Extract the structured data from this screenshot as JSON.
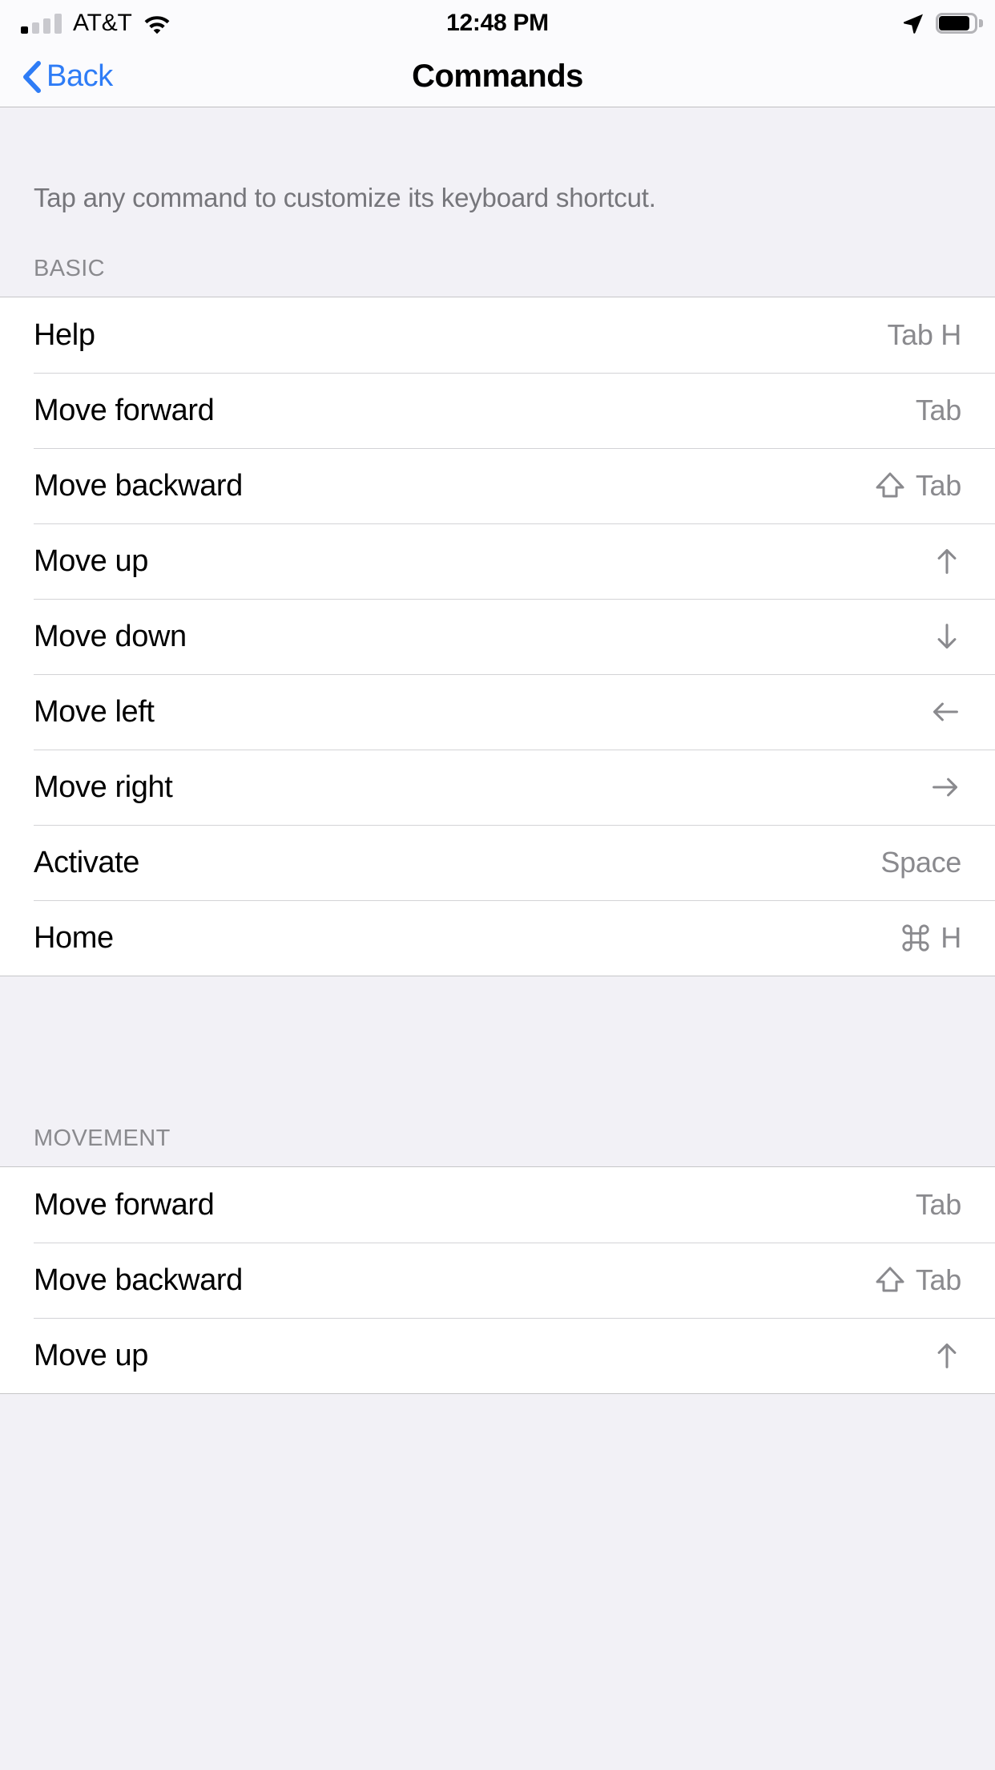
{
  "status_bar": {
    "carrier": "AT&T",
    "time": "12:48 PM",
    "signal_bars_filled": 1,
    "signal_bars_total": 4,
    "wifi_icon": "wifi-icon",
    "location_icon": "location-arrow-icon",
    "battery_icon": "battery-full-icon"
  },
  "nav_bar": {
    "back_label": "Back",
    "back_icon": "chevron-left-icon",
    "title": "Commands"
  },
  "intro": {
    "text": "Tap any command to customize its keyboard shortcut."
  },
  "colors": {
    "accent": "#2E7CF6",
    "grouped_background": "#F2F1F6",
    "cell_background": "#FFFFFF",
    "secondary_text": "#8A8A8E",
    "separator": "#D3D3D6"
  },
  "sections": [
    {
      "header": "BASIC",
      "rows": [
        {
          "label": "Help",
          "value": "Tab H",
          "icon": ""
        },
        {
          "label": "Move forward",
          "value": "Tab",
          "icon": ""
        },
        {
          "label": "Move backward",
          "value": "Tab",
          "icon": "shift-icon"
        },
        {
          "label": "Move up",
          "value": "",
          "icon": "arrow-up-icon"
        },
        {
          "label": "Move down",
          "value": "",
          "icon": "arrow-down-icon"
        },
        {
          "label": "Move left",
          "value": "",
          "icon": "arrow-left-icon"
        },
        {
          "label": "Move right",
          "value": "",
          "icon": "arrow-right-icon"
        },
        {
          "label": "Activate",
          "value": "Space",
          "icon": ""
        },
        {
          "label": "Home",
          "value": "H",
          "icon": "command-icon"
        }
      ]
    },
    {
      "header": "MOVEMENT",
      "rows": [
        {
          "label": "Move forward",
          "value": "Tab",
          "icon": ""
        },
        {
          "label": "Move backward",
          "value": "Tab",
          "icon": "shift-icon"
        },
        {
          "label": "Move up",
          "value": "",
          "icon": "arrow-up-icon"
        }
      ]
    }
  ]
}
